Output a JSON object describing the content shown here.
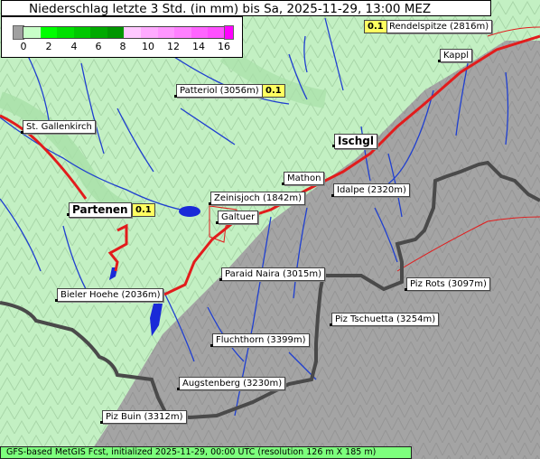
{
  "title": "Niederschlag letzte 3 Std. (in mm) bis Sa, 2025-11-29, 13:00 MEZ",
  "legend": {
    "ticks": [
      "0",
      "2",
      "4",
      "6",
      "8",
      "10",
      "12",
      "14",
      "16"
    ],
    "colors": [
      "#a0a0a0",
      "#c8ffc8",
      "#00ff00",
      "#00c800",
      "#009600",
      "#ffc8ff",
      "#ff96ff",
      "#ff64ff",
      "#ff00ff"
    ]
  },
  "places": [
    {
      "name": "Rendelspitze (2816m)",
      "value": "0.1"
    },
    {
      "name": "Kappl"
    },
    {
      "name": "Patteriol (3056m)",
      "value": "0.1"
    },
    {
      "name": "St. Gallenkirch"
    },
    {
      "name": "Ischgl"
    },
    {
      "name": "Mathon"
    },
    {
      "name": "Idalpe (2320m)"
    },
    {
      "name": "Zeinisjoch (1842m)"
    },
    {
      "name": "Partenen",
      "value": "0.1"
    },
    {
      "name": "Galtuer"
    },
    {
      "name": "Paraid Naira (3015m)"
    },
    {
      "name": "Piz Rots (3097m)"
    },
    {
      "name": "Bieler Hoehe (2036m)"
    },
    {
      "name": "Piz Tschuetta (3254m)"
    },
    {
      "name": "Fluchthorn (3399m)"
    },
    {
      "name": "Augstenberg (3230m)"
    },
    {
      "name": "Piz Buin (3312m)"
    }
  ],
  "footer": "GFS-based MetGIS Fcst, initialized 2025-11-29, 00:00 UTC  (resolution 126 m X 185 m)"
}
